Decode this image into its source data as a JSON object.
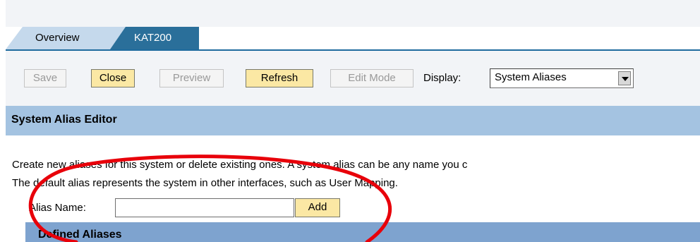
{
  "tabs": [
    {
      "label": "Overview",
      "selected": false
    },
    {
      "label": "KAT200",
      "selected": true
    }
  ],
  "toolbar": {
    "buttons": [
      {
        "label": "Save",
        "enabled": false
      },
      {
        "label": "Close",
        "enabled": true
      },
      {
        "label": "Preview",
        "enabled": false
      },
      {
        "label": "Refresh",
        "enabled": true
      },
      {
        "label": "Edit Mode",
        "enabled": false
      }
    ],
    "display_label": "Display:",
    "display_value": "System Aliases"
  },
  "editor": {
    "title": "System Alias Editor",
    "description_line1": "Create new aliases for this system or delete existing ones. A system alias can be any name you c",
    "description_line2": "The default alias represents the system in other interfaces, such as User Mapping.",
    "alias_label": "Alias Name:",
    "alias_value": "",
    "add_label": "Add",
    "defined_title": "Defined Aliases"
  },
  "colors": {
    "tab_selected": "#2a6f9a",
    "tab_unselected": "#c5d9ec",
    "button_active": "#fbe8a4",
    "section_header": "#a4c3e1",
    "sub_header": "#7ea3cf",
    "annotation": "#e8000a"
  }
}
